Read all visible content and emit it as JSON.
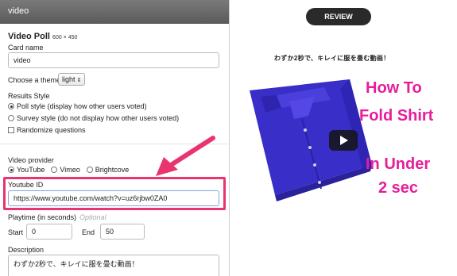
{
  "topbar": {
    "title": "video"
  },
  "panel": {
    "title": "Video Poll",
    "dimensions": "600 × 450",
    "card_name_label": "Card name",
    "card_name_value": "video",
    "theme_label": "Choose a theme",
    "theme_value": "light",
    "results_label": "Results Style",
    "poll_style": "Poll style (display how other users voted)",
    "survey_style": "Survey style (do not display how other users voted)",
    "randomize": "Randomize questions",
    "provider_label": "Video provider",
    "providers": [
      "YouTube",
      "Vimeo",
      "Brightcove"
    ],
    "youtube_label": "Youtube ID",
    "youtube_value": "https://www.youtube.com/watch?v=uz6rjbw0ZA0",
    "playtime_label": "Playtime (in seconds)",
    "optional": "Optional",
    "start_label": "Start",
    "start_value": "0",
    "end_label": "End",
    "end_value": "50",
    "description_label": "Description",
    "description_value": "わずか2秒で、キレイに服を畳む動画！"
  },
  "preview": {
    "review_button": "REVIEW",
    "caption": "わずか2秒で、キレイに服を畳む動画！",
    "overlay_lines": [
      "How To",
      "Fold Shirt",
      "In Under",
      "2 sec"
    ]
  },
  "colors": {
    "highlight": "#e8356f",
    "overlay_text": "#e61e9b",
    "shirt": "#3a2ec9"
  }
}
